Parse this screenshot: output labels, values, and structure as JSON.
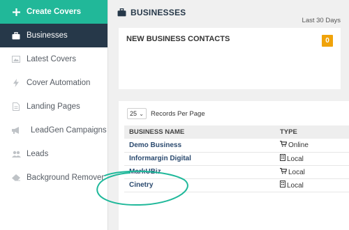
{
  "sidebar": {
    "items": [
      {
        "label": "Create Covers",
        "icon": "plus-icon"
      },
      {
        "label": "Businesses",
        "icon": "briefcase-icon"
      },
      {
        "label": "Latest Covers",
        "icon": "image-icon"
      },
      {
        "label": "Cover Automation",
        "icon": "bolt-icon"
      },
      {
        "label": "Landing Pages",
        "icon": "file-icon"
      },
      {
        "label": "LeadGen Campaigns",
        "icon": "bullhorn-icon"
      },
      {
        "label": "Leads",
        "icon": "users-icon"
      },
      {
        "label": "Background Remover",
        "icon": "eraser-icon"
      }
    ]
  },
  "header": {
    "title": "BUSINESSES",
    "period": "Last 30 Days"
  },
  "contacts_card": {
    "title": "NEW BUSINESS CONTACTS",
    "count": "0"
  },
  "table_controls": {
    "per_page_value": "25",
    "per_page_label": "Records Per Page"
  },
  "table": {
    "headers": [
      "BUSINESS NAME",
      "TYPE"
    ],
    "rows": [
      {
        "name": "Demo Business",
        "type": "Online",
        "type_icon": "cart-icon"
      },
      {
        "name": "Informargin Digital",
        "type": "Local",
        "type_icon": "building-icon"
      },
      {
        "name": "MarkUBiz",
        "type": "Local",
        "type_icon": "cart-icon"
      },
      {
        "name": "Cinetry",
        "type": "Local",
        "type_icon": "building-icon"
      }
    ]
  },
  "colors": {
    "sidebar_accent": "#21b899",
    "sidebar_active": "#263849",
    "badge": "#f0a30a",
    "annotation_circle": "#1fb89a"
  }
}
